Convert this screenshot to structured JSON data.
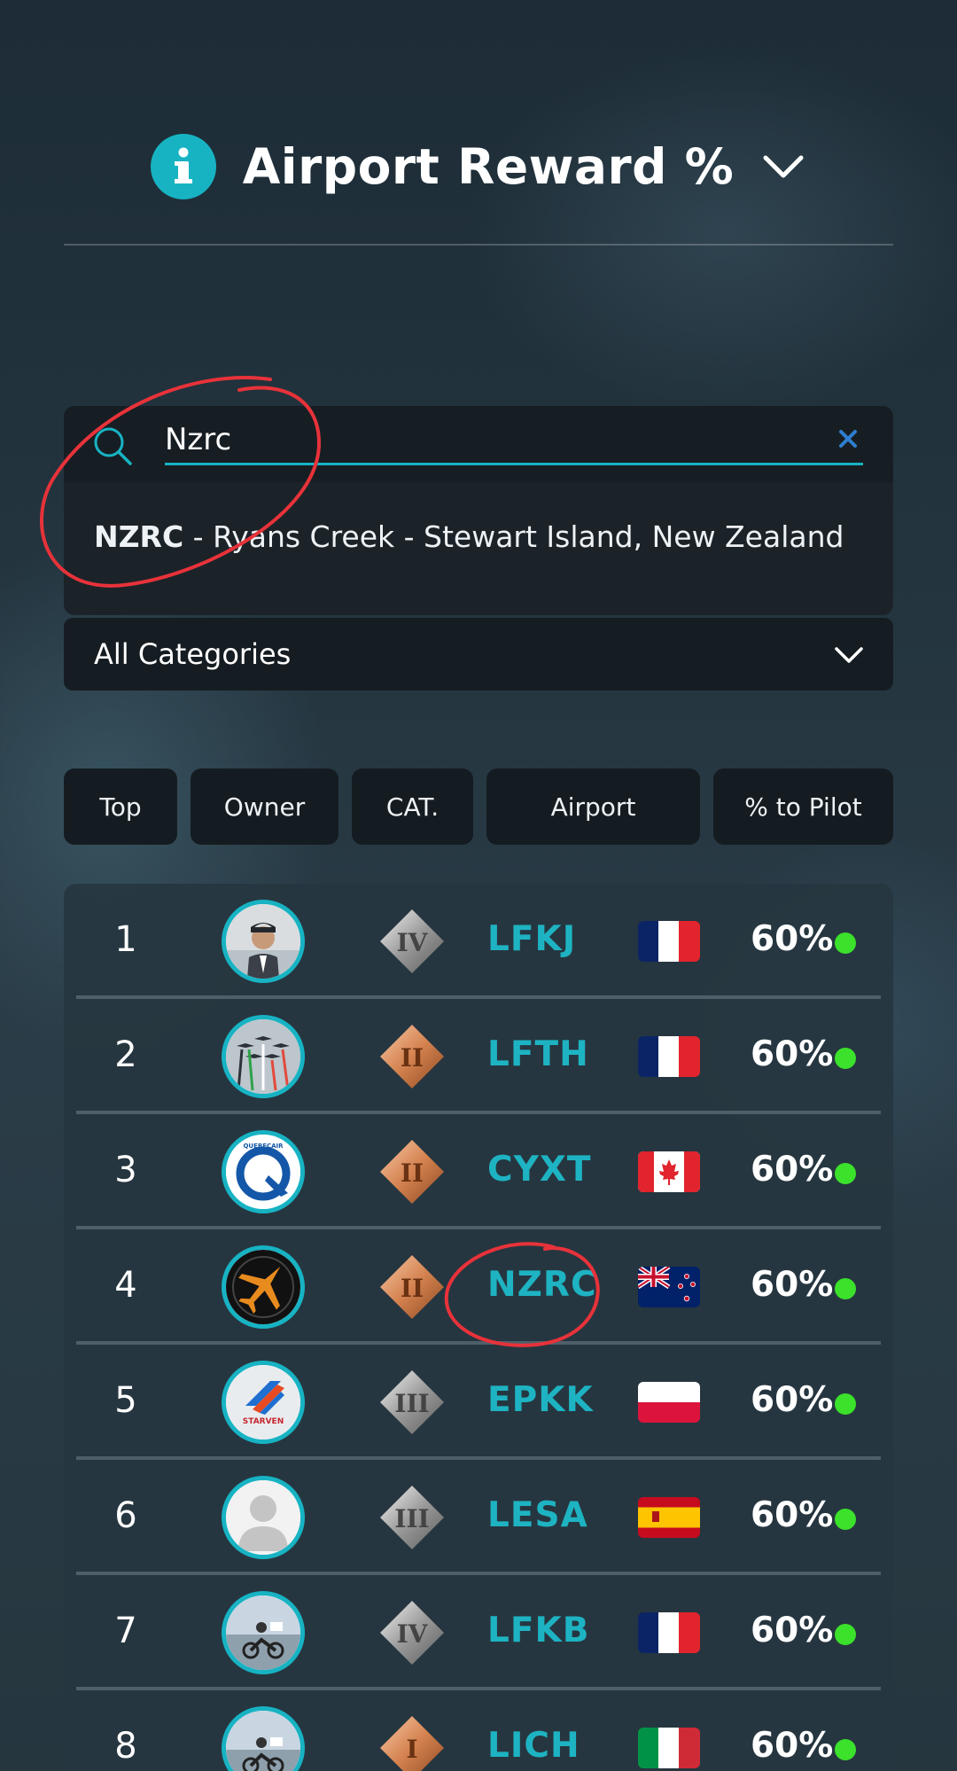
{
  "header": {
    "title": "Airport Reward %"
  },
  "search": {
    "value": "Nzrc",
    "placeholder": ""
  },
  "suggestion": {
    "code": "NZRC",
    "text": " - Ryans Creek - Stewart Island, New Zealand"
  },
  "filter": {
    "selected": "All Categories"
  },
  "columns": [
    "Top",
    "Owner",
    "CAT.",
    "Airport",
    "% to Pilot"
  ],
  "rows": [
    {
      "rank": "1",
      "category": "IV",
      "code": "LFKJ",
      "country": "France",
      "percent": "60%"
    },
    {
      "rank": "2",
      "category": "II",
      "code": "LFTH",
      "country": "France",
      "percent": "60%"
    },
    {
      "rank": "3",
      "category": "II",
      "code": "CYXT",
      "country": "Canada",
      "percent": "60%"
    },
    {
      "rank": "4",
      "category": "II",
      "code": "NZRC",
      "country": "New Zealand",
      "percent": "60%"
    },
    {
      "rank": "5",
      "category": "III",
      "code": "EPKK",
      "country": "Poland",
      "percent": "60%"
    },
    {
      "rank": "6",
      "category": "III",
      "code": "LESA",
      "country": "Spain",
      "percent": "60%"
    },
    {
      "rank": "7",
      "category": "IV",
      "code": "LFKB",
      "country": "France",
      "percent": "60%"
    },
    {
      "rank": "8",
      "category": "I",
      "code": "LICH",
      "country": "Italy",
      "percent": "60%"
    }
  ],
  "colors": {
    "accent": "#17b3c3",
    "status_online": "#3be12b",
    "bronze": "#d4824f",
    "silver": "#9a9a9a",
    "annotation": "#e8323a"
  }
}
